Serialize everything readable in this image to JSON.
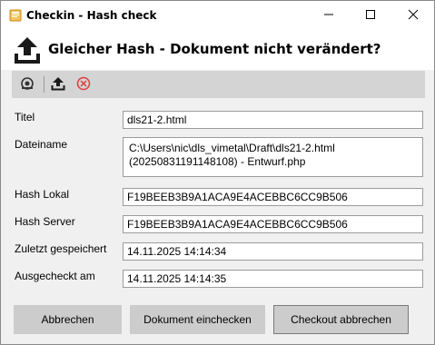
{
  "window": {
    "title": "Checkin - Hash check",
    "icons": {
      "app": "app-icon",
      "minimize": "minimize-icon",
      "maximize": "maximize-icon",
      "close": "close-icon"
    }
  },
  "header": {
    "title": "Gleicher Hash - Dokument nicht verändert?",
    "icon": "upload-icon"
  },
  "toolbar": {
    "items": [
      {
        "icon": "reset-icon"
      },
      {
        "icon": "checkin-icon"
      },
      {
        "icon": "cancel-icon",
        "color": "#e03c3c"
      }
    ]
  },
  "form": {
    "titel": {
      "label": "Titel",
      "value": "dls21-2.html"
    },
    "dateiname": {
      "label": "Dateiname",
      "value_line1": "C:\\Users\\nic\\dls_vimetal\\Draft\\dls21-2.html",
      "value_line2": "(20250831191148108) - Entwurf.php"
    },
    "hash_lokal": {
      "label": "Hash Lokal",
      "value": "F19BEEB3B9A1ACA9E4ACEBBC6CC9B506"
    },
    "hash_server": {
      "label": "Hash Server",
      "value": "F19BEEB3B9A1ACA9E4ACEBBC6CC9B506"
    },
    "zuletzt": {
      "label": "Zuletzt gespeichert",
      "value": "14.11.2025 14:14:34"
    },
    "ausgecheckt": {
      "label": "Ausgecheckt am",
      "value": "14.11.2025 14:14:35"
    }
  },
  "buttons": {
    "abbrechen": "Abbrechen",
    "einchecken": "Dokument einchecken",
    "checkout_abbrechen": "Checkout abbrechen"
  },
  "colors": {
    "toolbar_bg": "#d4d4d4",
    "button_bg": "#cccccc",
    "window_bg": "#f0f0f0",
    "cancel_red": "#e03c3c"
  }
}
